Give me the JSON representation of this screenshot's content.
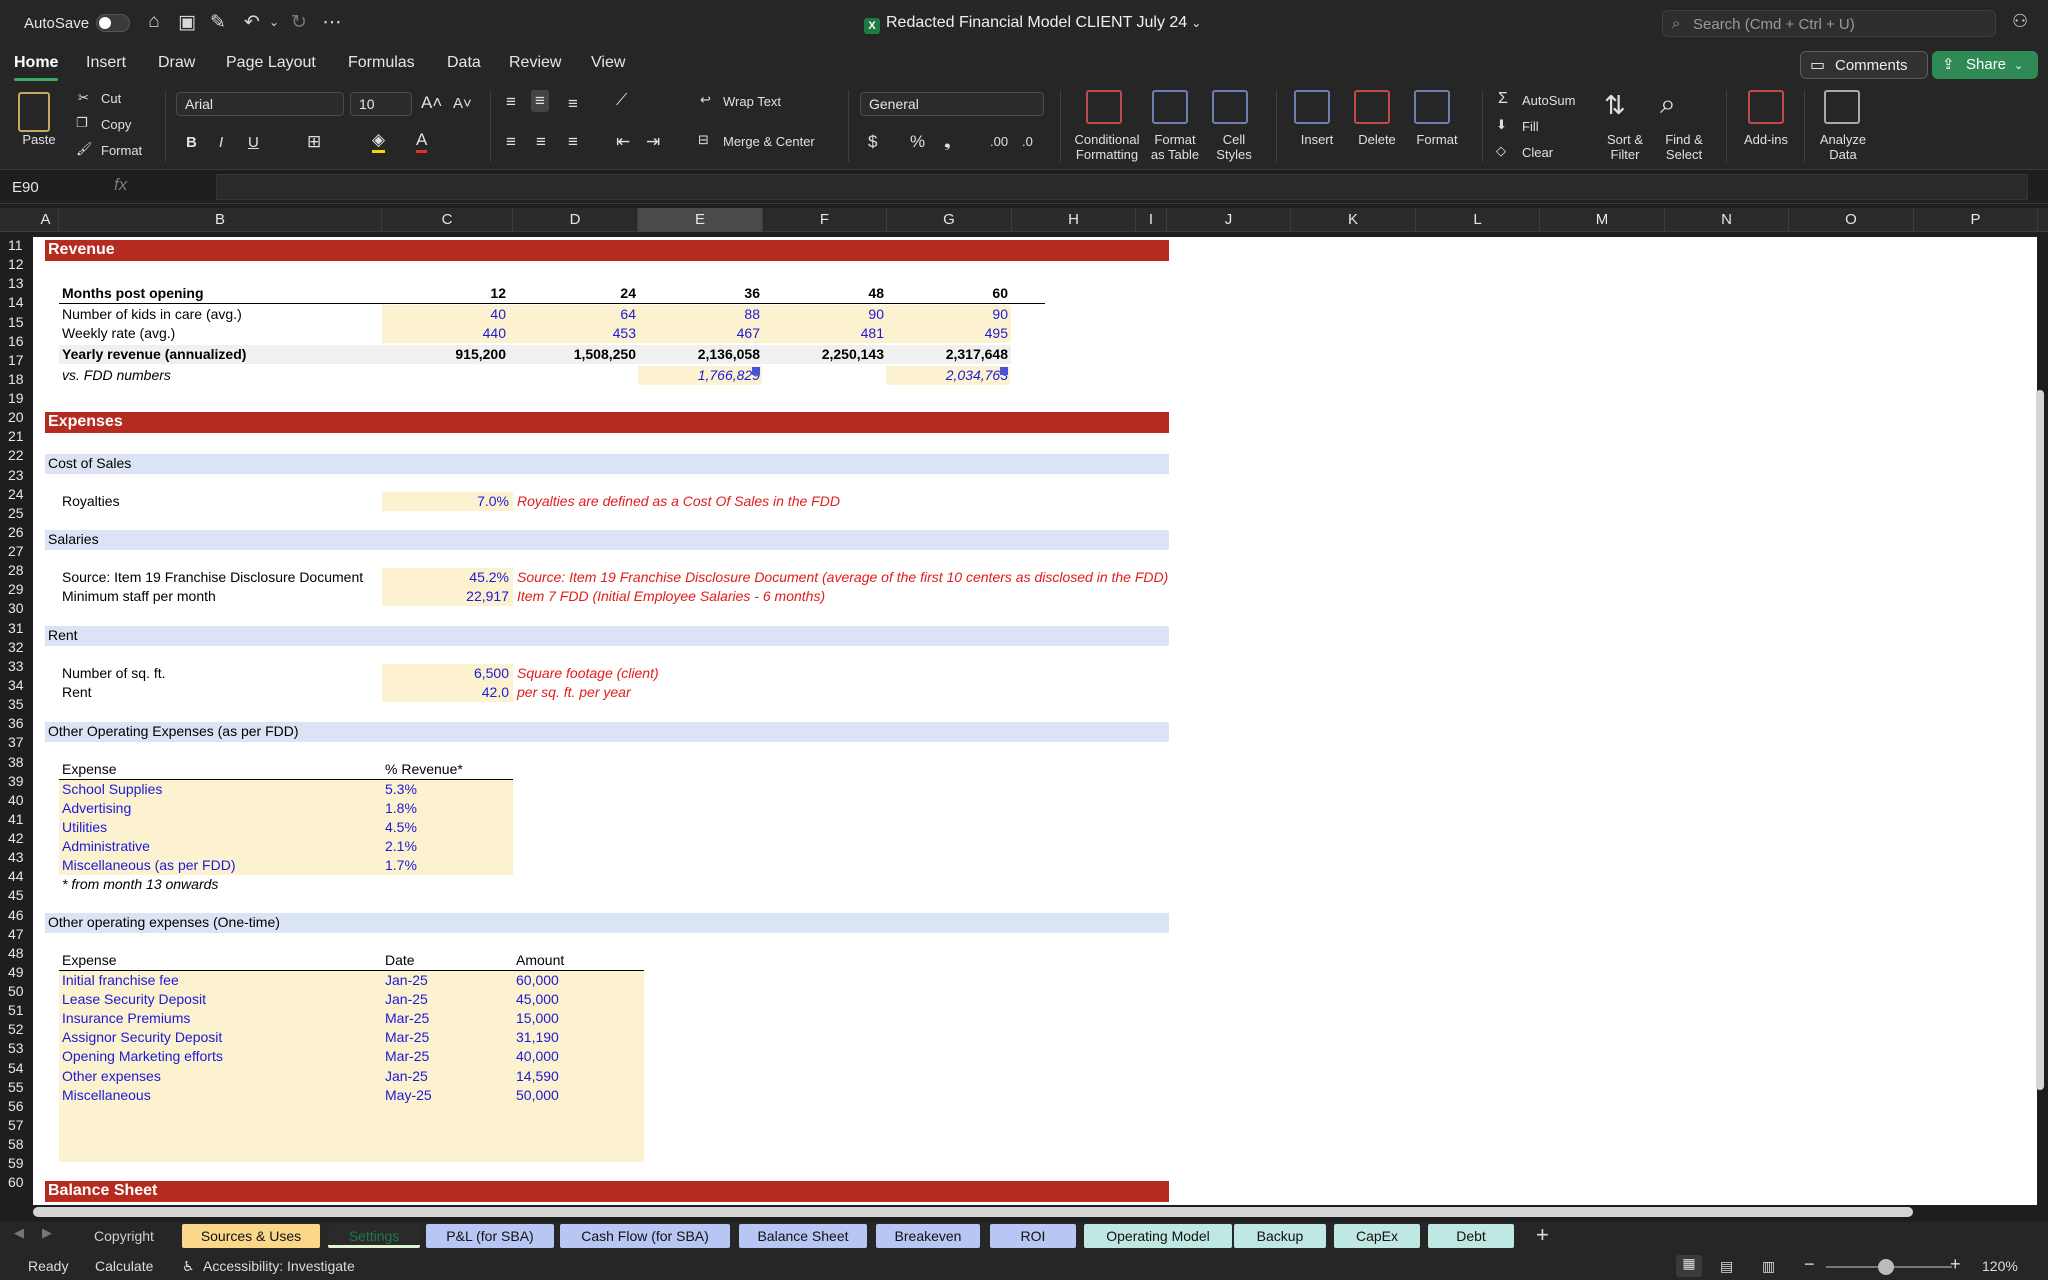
{
  "titlebar": {
    "autosave_label": "AutoSave",
    "document_title": "Redacted Financial Model CLIENT July 24",
    "search_placeholder": "Search (Cmd + Ctrl + U)"
  },
  "menu": {
    "tabs": [
      "Home",
      "Insert",
      "Draw",
      "Page Layout",
      "Formulas",
      "Data",
      "Review",
      "View"
    ],
    "active": "Home",
    "comments_label": "Comments",
    "share_label": "Share"
  },
  "ribbon": {
    "paste": "Paste",
    "cut": "Cut",
    "copy": "Copy",
    "format_painter": "Format",
    "font_name": "Arial",
    "font_size": "10",
    "bold": "B",
    "italic": "I",
    "underline": "U",
    "wrap_text": "Wrap Text",
    "merge_center": "Merge & Center",
    "number_format": "General",
    "conditional_formatting": "Conditional\nFormatting",
    "format_as_table": "Format\nas Table",
    "cell_styles": "Cell\nStyles",
    "insert": "Insert",
    "delete": "Delete",
    "format": "Format",
    "autosum": "AutoSum",
    "fill": "Fill",
    "clear": "Clear",
    "sort_filter": "Sort &\nFilter",
    "find_select": "Find &\nSelect",
    "add_ins": "Add-ins",
    "analyze_data": "Analyze\nData"
  },
  "formula_bar": {
    "name_box": "E90",
    "fx": "fx",
    "formula": ""
  },
  "columns": [
    "A",
    "B",
    "C",
    "D",
    "E",
    "F",
    "G",
    "H",
    "I",
    "J",
    "K",
    "L",
    "M",
    "N",
    "O",
    "P"
  ],
  "selected_column": "E",
  "rows": [
    "11",
    "12",
    "13",
    "14",
    "15",
    "16",
    "17",
    "18",
    "19",
    "20",
    "21",
    "22",
    "23",
    "24",
    "25",
    "26",
    "27",
    "28",
    "29",
    "30",
    "31",
    "32",
    "33",
    "34",
    "35",
    "36",
    "37",
    "38",
    "39",
    "40",
    "41",
    "42",
    "43",
    "44",
    "45",
    "46",
    "47",
    "48",
    "49",
    "50",
    "51",
    "52",
    "53",
    "54",
    "55",
    "56",
    "57",
    "58",
    "59",
    "60"
  ],
  "revenue": {
    "title": "Revenue",
    "months_label": "Months post opening",
    "months": [
      "12",
      "24",
      "36",
      "48",
      "60"
    ],
    "kids_label": "Number of kids in care (avg.)",
    "kids": [
      "40",
      "64",
      "88",
      "90",
      "90"
    ],
    "weekly_label": "Weekly rate (avg.)",
    "weekly": [
      "440",
      "453",
      "467",
      "481",
      "495"
    ],
    "yearly_label": "Yearly revenue (annualized)",
    "yearly": [
      "915,200",
      "1,508,250",
      "2,136,058",
      "2,250,143",
      "2,317,648"
    ],
    "fdd_label": "vs. FDD numbers",
    "fdd_e": "1,766,829",
    "fdd_g": "2,034,763"
  },
  "expenses": {
    "title": "Expenses",
    "cost_of_sales": "Cost of Sales",
    "royalties_label": "Royalties",
    "royalties_value": "7.0%",
    "royalties_note": "Royalties are defined as a Cost Of Sales in the FDD",
    "salaries": "Salaries",
    "source_label": "Source: Item 19 Franchise Disclosure Document",
    "source_value": "45.2%",
    "source_note": "Source: Item 19 Franchise Disclosure Document (average of the first 10 centers as disclosed in the FDD)",
    "min_staff_label": "Minimum staff per month",
    "min_staff_value": "22,917",
    "min_staff_note": "Item 7 FDD (Initial Employee Salaries - 6 months)",
    "rent": "Rent",
    "sqft_label": "Number of sq. ft.",
    "sqft_value": "6,500",
    "sqft_note": "Square footage (client)",
    "rent_label": "Rent",
    "rent_value": "42.0",
    "rent_note": "per sq. ft. per year",
    "other_opex": "Other Operating Expenses (as per FDD)",
    "opex_header_expense": "Expense",
    "opex_header_pct": "% Revenue*",
    "opex_items": [
      {
        "name": "School Supplies",
        "pct": "5.3%"
      },
      {
        "name": "Advertising",
        "pct": "1.8%"
      },
      {
        "name": "Utilities",
        "pct": "4.5%"
      },
      {
        "name": "Administrative",
        "pct": "2.1%"
      },
      {
        "name": "Miscellaneous (as per FDD)",
        "pct": "1.7%"
      }
    ],
    "opex_footnote": "* from month 13 onwards",
    "one_time": "Other operating expenses (One-time)",
    "ot_header_expense": "Expense",
    "ot_header_date": "Date",
    "ot_header_amount": "Amount",
    "ot_items": [
      {
        "name": "Initial franchise fee",
        "date": "Jan-25",
        "amount": "60,000"
      },
      {
        "name": "Lease Security Deposit",
        "date": "Jan-25",
        "amount": "45,000"
      },
      {
        "name": "Insurance Premiums",
        "date": "Mar-25",
        "amount": "15,000"
      },
      {
        "name": "Assignor Security Deposit",
        "date": "Mar-25",
        "amount": "31,190"
      },
      {
        "name": "Opening Marketing efforts",
        "date": "Mar-25",
        "amount": "40,000"
      },
      {
        "name": "Other expenses",
        "date": "Jan-25",
        "amount": "14,590"
      },
      {
        "name": "Miscellaneous",
        "date": "May-25",
        "amount": "50,000"
      }
    ]
  },
  "balance_sheet_title": "Balance Sheet",
  "sheet_tabs": [
    {
      "label": "Copyright",
      "color": ""
    },
    {
      "label": "Sources & Uses",
      "color": "#fbd78a"
    },
    {
      "label": "Settings",
      "color": "#dff5d2"
    },
    {
      "label": "P&L (for SBA)",
      "color": "#b8c6f3"
    },
    {
      "label": "Cash Flow (for SBA)",
      "color": "#b8c6f3"
    },
    {
      "label": "Balance Sheet",
      "color": "#b8c6f3"
    },
    {
      "label": "Breakeven",
      "color": "#b8c6f3"
    },
    {
      "label": "ROI",
      "color": "#b8c6f3"
    },
    {
      "label": "Operating Model",
      "color": "#bfe8e3"
    },
    {
      "label": "Backup",
      "color": "#bfe8e3"
    },
    {
      "label": "CapEx",
      "color": "#bfe8e3"
    },
    {
      "label": "Debt",
      "color": "#bfe8e3"
    }
  ],
  "status": {
    "ready": "Ready",
    "calculate": "Calculate",
    "accessibility": "Accessibility: Investigate",
    "zoom": "120%"
  }
}
